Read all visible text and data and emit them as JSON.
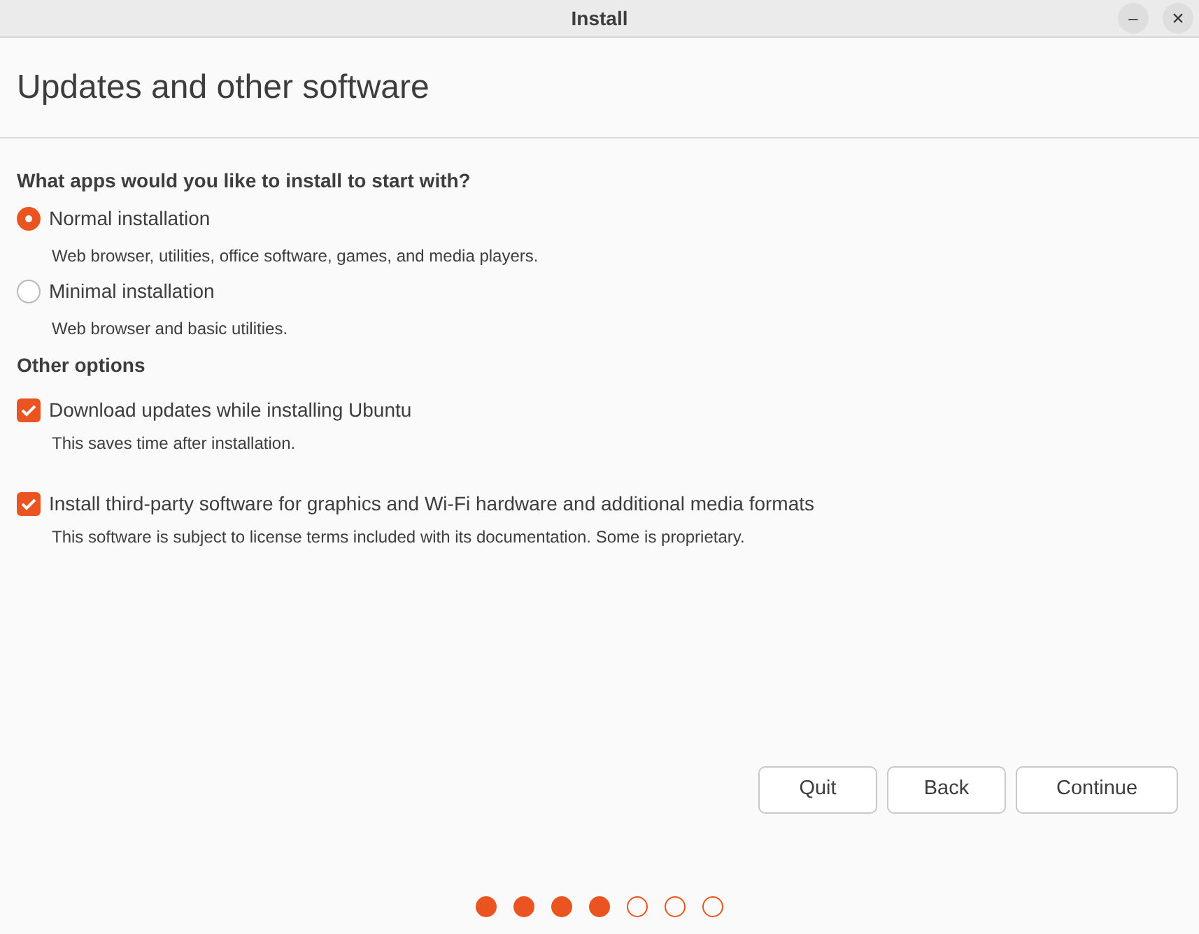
{
  "window": {
    "title": "Install",
    "controls": [
      {
        "kind": "minimize",
        "label": "–"
      },
      {
        "kind": "close",
        "label": "×"
      }
    ]
  },
  "heading": "Updates and other software",
  "apps_section": {
    "title": "What apps would you like to install to start with?",
    "options": [
      {
        "label": "Normal installation",
        "description": "Web browser, utilities, office software, games, and media players.",
        "selected": true
      },
      {
        "label": "Minimal installation",
        "description": "Web browser and basic utilities.",
        "selected": false
      }
    ]
  },
  "other_section": {
    "title": "Other options",
    "options": [
      {
        "label": "Download updates while installing Ubuntu",
        "description": "This saves time after installation.",
        "checked": true
      },
      {
        "label": "Install third-party software for graphics and Wi-Fi hardware and additional media formats",
        "description": "This software is subject to license terms included with its documentation. Some is proprietary.",
        "checked": true
      }
    ]
  },
  "buttons": [
    "Quit",
    "Back",
    "Continue"
  ],
  "steps": [
    {
      "done": true
    },
    {
      "done": true
    },
    {
      "done": true
    },
    {
      "done": true
    },
    {
      "done": false
    },
    {
      "done": false
    },
    {
      "done": false
    }
  ]
}
